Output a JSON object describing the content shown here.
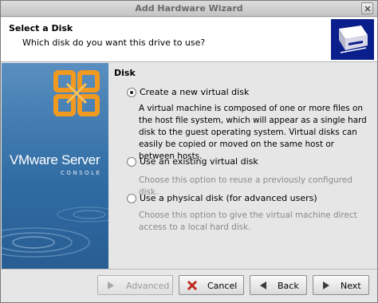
{
  "window": {
    "title": "Add Hardware Wizard"
  },
  "header": {
    "title": "Select a Disk",
    "subtitle": "Which disk do you want this drive to use?",
    "icon": "hardware-disk-icon"
  },
  "banner": {
    "brand": "VMware Server",
    "brand_sub": "CONSOLE"
  },
  "section": {
    "label": "Disk"
  },
  "options": [
    {
      "label": "Create a new virtual disk",
      "checked": true,
      "description": "A virtual machine is composed of one or more files on the host file system, which will appear as a single hard disk to the guest operating system.  Virtual disks can easily be copied or moved on the same host or between hosts."
    },
    {
      "label": "Use an existing virtual disk",
      "checked": false,
      "description": "Choose this option to reuse a previously configured disk."
    },
    {
      "label": "Use a physical disk (for advanced users)",
      "checked": false,
      "description": "Choose this option to give the virtual machine direct access to a local hard disk."
    }
  ],
  "buttons": {
    "advanced": "Advanced",
    "cancel": "Cancel",
    "back": "Back",
    "next": "Next"
  },
  "colors": {
    "banner": "#3f79ae",
    "header_icon_bg": "#0a1f8c",
    "cancel_icon": "#c0281e",
    "logo_orange": "#f29a1f"
  }
}
